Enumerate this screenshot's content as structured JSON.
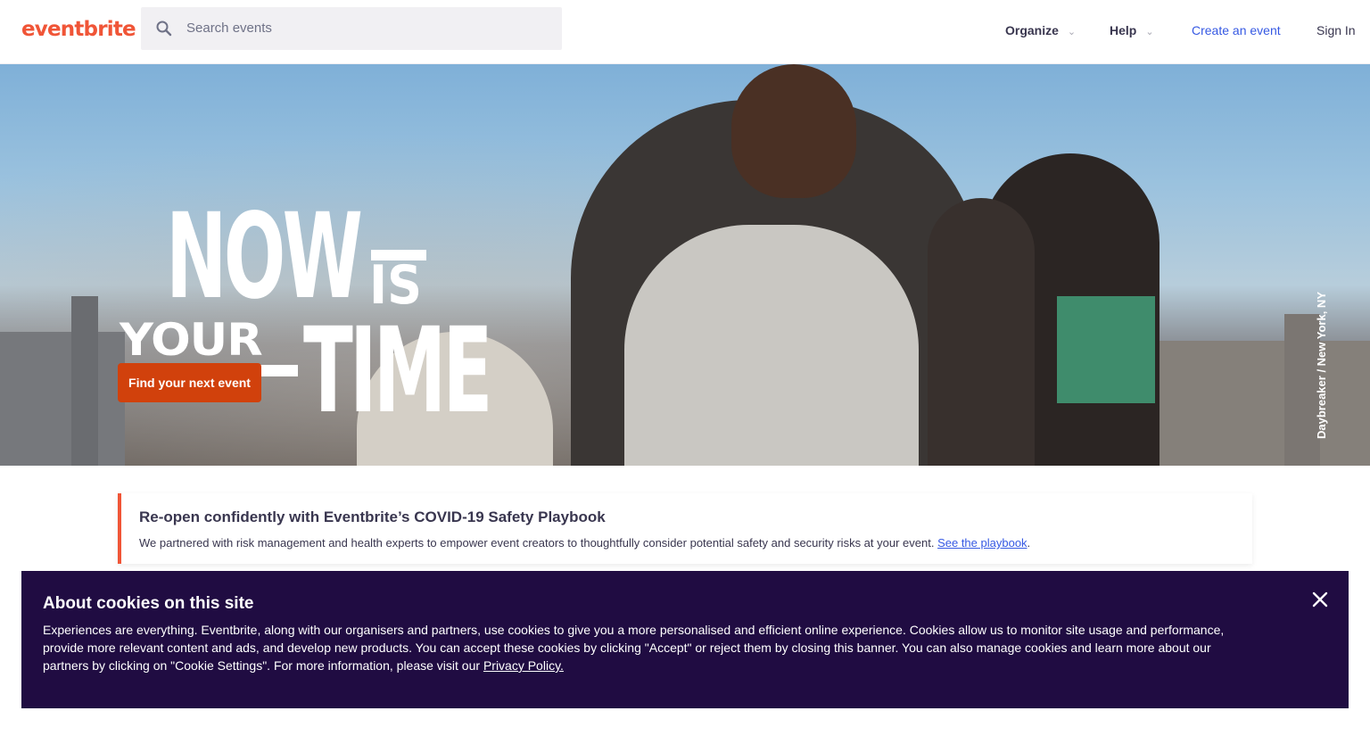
{
  "header": {
    "logo": "eventbrite",
    "search_placeholder": "Search events",
    "nav": {
      "organize": "Organize",
      "help": "Help",
      "create": "Create an event",
      "signin": "Sign In"
    }
  },
  "hero": {
    "headline": {
      "now": "NOW",
      "is": "IS",
      "your": "YOUR",
      "time": "TIME"
    },
    "cta": "Find your next event",
    "photo_caption": "Daybreaker / New York, NY"
  },
  "notice": {
    "title": "Re-open confidently with Eventbrite’s COVID-19 Safety Playbook",
    "body": "We partnered with risk management and health experts to empower event creators to thoughtfully consider potential safety and security risks at your event.",
    "link": "See the playbook"
  },
  "cookie": {
    "title": "About cookies on this site",
    "text": "Experiences are everything. Eventbrite, along with our organisers and partners, use cookies to give you a more personalised and efficient online experience. Cookies allow us to monitor site usage and performance, provide more relevant content and ads, and develop new products. You can accept these cookies by clicking \"Accept\" or reject them by closing this banner. You can also manage cookies and learn more about our partners by clicking on \"Cookie Settings\". For more information, please visit our",
    "link": "Privacy Policy."
  },
  "colors": {
    "brand": "#f05537",
    "cta": "#d1410c",
    "link": "#3659e3",
    "cookie_bg": "#200c42"
  },
  "icons": {
    "search": "search-icon",
    "chevron": "chevron-down-icon",
    "close": "close-icon"
  }
}
